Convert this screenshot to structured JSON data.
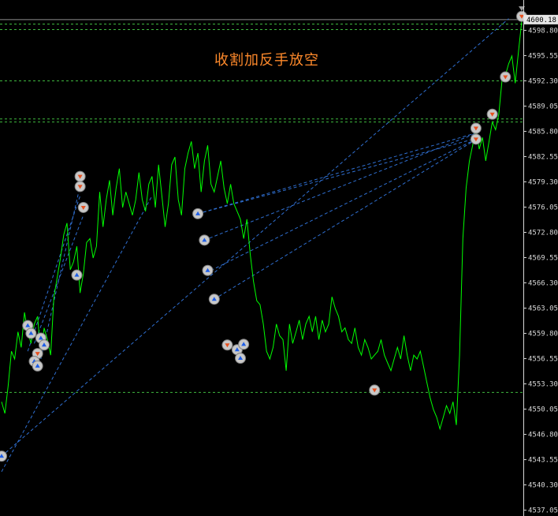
{
  "chart_data": {
    "type": "line",
    "title": "收割加反手放空",
    "current_price": 4600.18,
    "ylim": [
      4536.5,
      4602.5
    ],
    "y_ticks": [
      "4598.80",
      "4595.55",
      "4592.30",
      "4589.05",
      "4585.80",
      "4582.55",
      "4579.30",
      "4576.05",
      "4572.80",
      "4569.55",
      "4566.30",
      "4563.05",
      "4559.80",
      "4556.55",
      "4553.30",
      "4550.05",
      "4546.80",
      "4543.55",
      "4540.30",
      "4537.05"
    ],
    "hlines": [
      4599.6,
      4598.9,
      4592.3,
      4587.4,
      4587.0,
      4552.2
    ],
    "series": [
      {
        "values": [
          4551.0,
          4549.5,
          4553.0,
          4557.5,
          4556.5,
          4560.0,
          4558.0,
          4562.5,
          4560.0,
          4558.5,
          4561.0,
          4562.0,
          4557.0,
          4560.5,
          4559.0,
          4557.0,
          4564.5,
          4567.0,
          4569.5,
          4572.5,
          4574.0,
          4568.0,
          4569.0,
          4571.0,
          4565.0,
          4567.5,
          4571.5,
          4572.0,
          4569.5,
          4571.0,
          4578.0,
          4573.5,
          4577.0,
          4579.5,
          4575.0,
          4578.5,
          4581.0,
          4576.0,
          4578.0,
          4576.5,
          4575.0,
          4577.0,
          4580.5,
          4577.0,
          4575.5,
          4579.0,
          4580.0,
          4576.0,
          4581.5,
          4577.5,
          4573.5,
          4576.5,
          4581.5,
          4582.5,
          4577.0,
          4575.0,
          4581.0,
          4583.0,
          4584.5,
          4581.0,
          4583.0,
          4578.0,
          4582.0,
          4584.0,
          4579.0,
          4578.0,
          4580.0,
          4582.0,
          4578.5,
          4576.5,
          4579.0,
          4576.5,
          4575.5,
          4574.5,
          4572.0,
          4574.5,
          4570.0,
          4566.5,
          4564.0,
          4563.5,
          4561.0,
          4557.5,
          4556.5,
          4558.0,
          4561.0,
          4559.5,
          4559.0,
          4555.0,
          4561.0,
          4558.5,
          4560.0,
          4561.5,
          4559.0,
          4561.0,
          4562.0,
          4560.0,
          4562.0,
          4559.0,
          4561.5,
          4560.0,
          4561.0,
          4564.5,
          4563.0,
          4562.0,
          4560.0,
          4560.5,
          4559.0,
          4558.5,
          4560.5,
          4558.0,
          4557.0,
          4559.0,
          4558.0,
          4556.5,
          4557.0,
          4557.5,
          4559.0,
          4557.0,
          4556.0,
          4555.0,
          4556.5,
          4558.0,
          4556.5,
          4559.5,
          4557.0,
          4555.0,
          4557.0,
          4556.5,
          4557.5,
          4555.5,
          4553.5,
          4551.5,
          4550.0,
          4549.0,
          4547.5,
          4549.0,
          4550.5,
          4549.5,
          4551.0,
          4548.0,
          4557.0,
          4572.0,
          4578.5,
          4582.0,
          4584.0,
          4586.5,
          4583.5,
          4585.0,
          4582.0,
          4584.5,
          4587.0,
          4586.0,
          4588.0,
          4592.5,
          4593.0,
          4594.5,
          4595.5,
          4592.0,
          4596.0,
          4600.0
        ]
      }
    ],
    "fib_lines": [
      {
        "from": [
          0,
          4544.0
        ],
        "to": [
          155,
          4600.3
        ]
      },
      {
        "from": [
          0,
          4542.0
        ],
        "to": [
          46,
          4577.5
        ]
      },
      {
        "from": [
          60,
          4575.2
        ],
        "to": [
          146,
          4585.7
        ]
      },
      {
        "from": [
          60,
          4575.2
        ],
        "to": [
          146,
          4585.0
        ]
      },
      {
        "from": [
          62,
          4571.8
        ],
        "to": [
          146,
          4585.7
        ]
      },
      {
        "from": [
          64,
          4567.9
        ],
        "to": [
          146,
          4585.0
        ]
      },
      {
        "from": [
          65,
          4564.2
        ],
        "to": [
          146,
          4585.0
        ]
      },
      {
        "from": [
          8,
          4557.5
        ],
        "to": [
          24,
          4577.5
        ]
      },
      {
        "from": [
          10,
          4558.5
        ],
        "to": [
          25,
          4575.0
        ]
      },
      {
        "from": [
          12,
          4556.5
        ],
        "to": [
          24,
          4578.8
        ]
      }
    ],
    "markers": [
      {
        "x": 24,
        "y": 4580.0,
        "dir": "sell"
      },
      {
        "x": 24,
        "y": 4578.7,
        "dir": "sell"
      },
      {
        "x": 25,
        "y": 4576.0,
        "dir": "sell"
      },
      {
        "x": 23,
        "y": 4567.3,
        "dir": "buy"
      },
      {
        "x": 8,
        "y": 4560.8,
        "dir": "buy"
      },
      {
        "x": 9,
        "y": 4559.8,
        "dir": "buy"
      },
      {
        "x": 12,
        "y": 4559.2,
        "dir": "buy"
      },
      {
        "x": 13,
        "y": 4558.3,
        "dir": "buy"
      },
      {
        "x": 11,
        "y": 4557.2,
        "dir": "sell"
      },
      {
        "x": 10,
        "y": 4556.2,
        "dir": "buy"
      },
      {
        "x": 11,
        "y": 4555.6,
        "dir": "buy"
      },
      {
        "x": 60,
        "y": 4575.2,
        "dir": "buy"
      },
      {
        "x": 62,
        "y": 4571.8,
        "dir": "buy"
      },
      {
        "x": 63,
        "y": 4567.9,
        "dir": "buy"
      },
      {
        "x": 65,
        "y": 4564.2,
        "dir": "buy"
      },
      {
        "x": 69,
        "y": 4558.3,
        "dir": "sell"
      },
      {
        "x": 72,
        "y": 4557.7,
        "dir": "buy"
      },
      {
        "x": 74,
        "y": 4558.4,
        "dir": "buy"
      },
      {
        "x": 73,
        "y": 4556.6,
        "dir": "buy"
      },
      {
        "x": 114,
        "y": 4552.5,
        "dir": "sell"
      },
      {
        "x": 145,
        "y": 4586.2,
        "dir": "sell"
      },
      {
        "x": 145,
        "y": 4584.8,
        "dir": "sell"
      },
      {
        "x": 150,
        "y": 4588.0,
        "dir": "sell"
      },
      {
        "x": 154,
        "y": 4592.8,
        "dir": "sell"
      },
      {
        "x": 159,
        "y": 4600.6,
        "dir": "sell"
      },
      {
        "x": 0,
        "y": 4544.0,
        "dir": "buy"
      }
    ]
  }
}
